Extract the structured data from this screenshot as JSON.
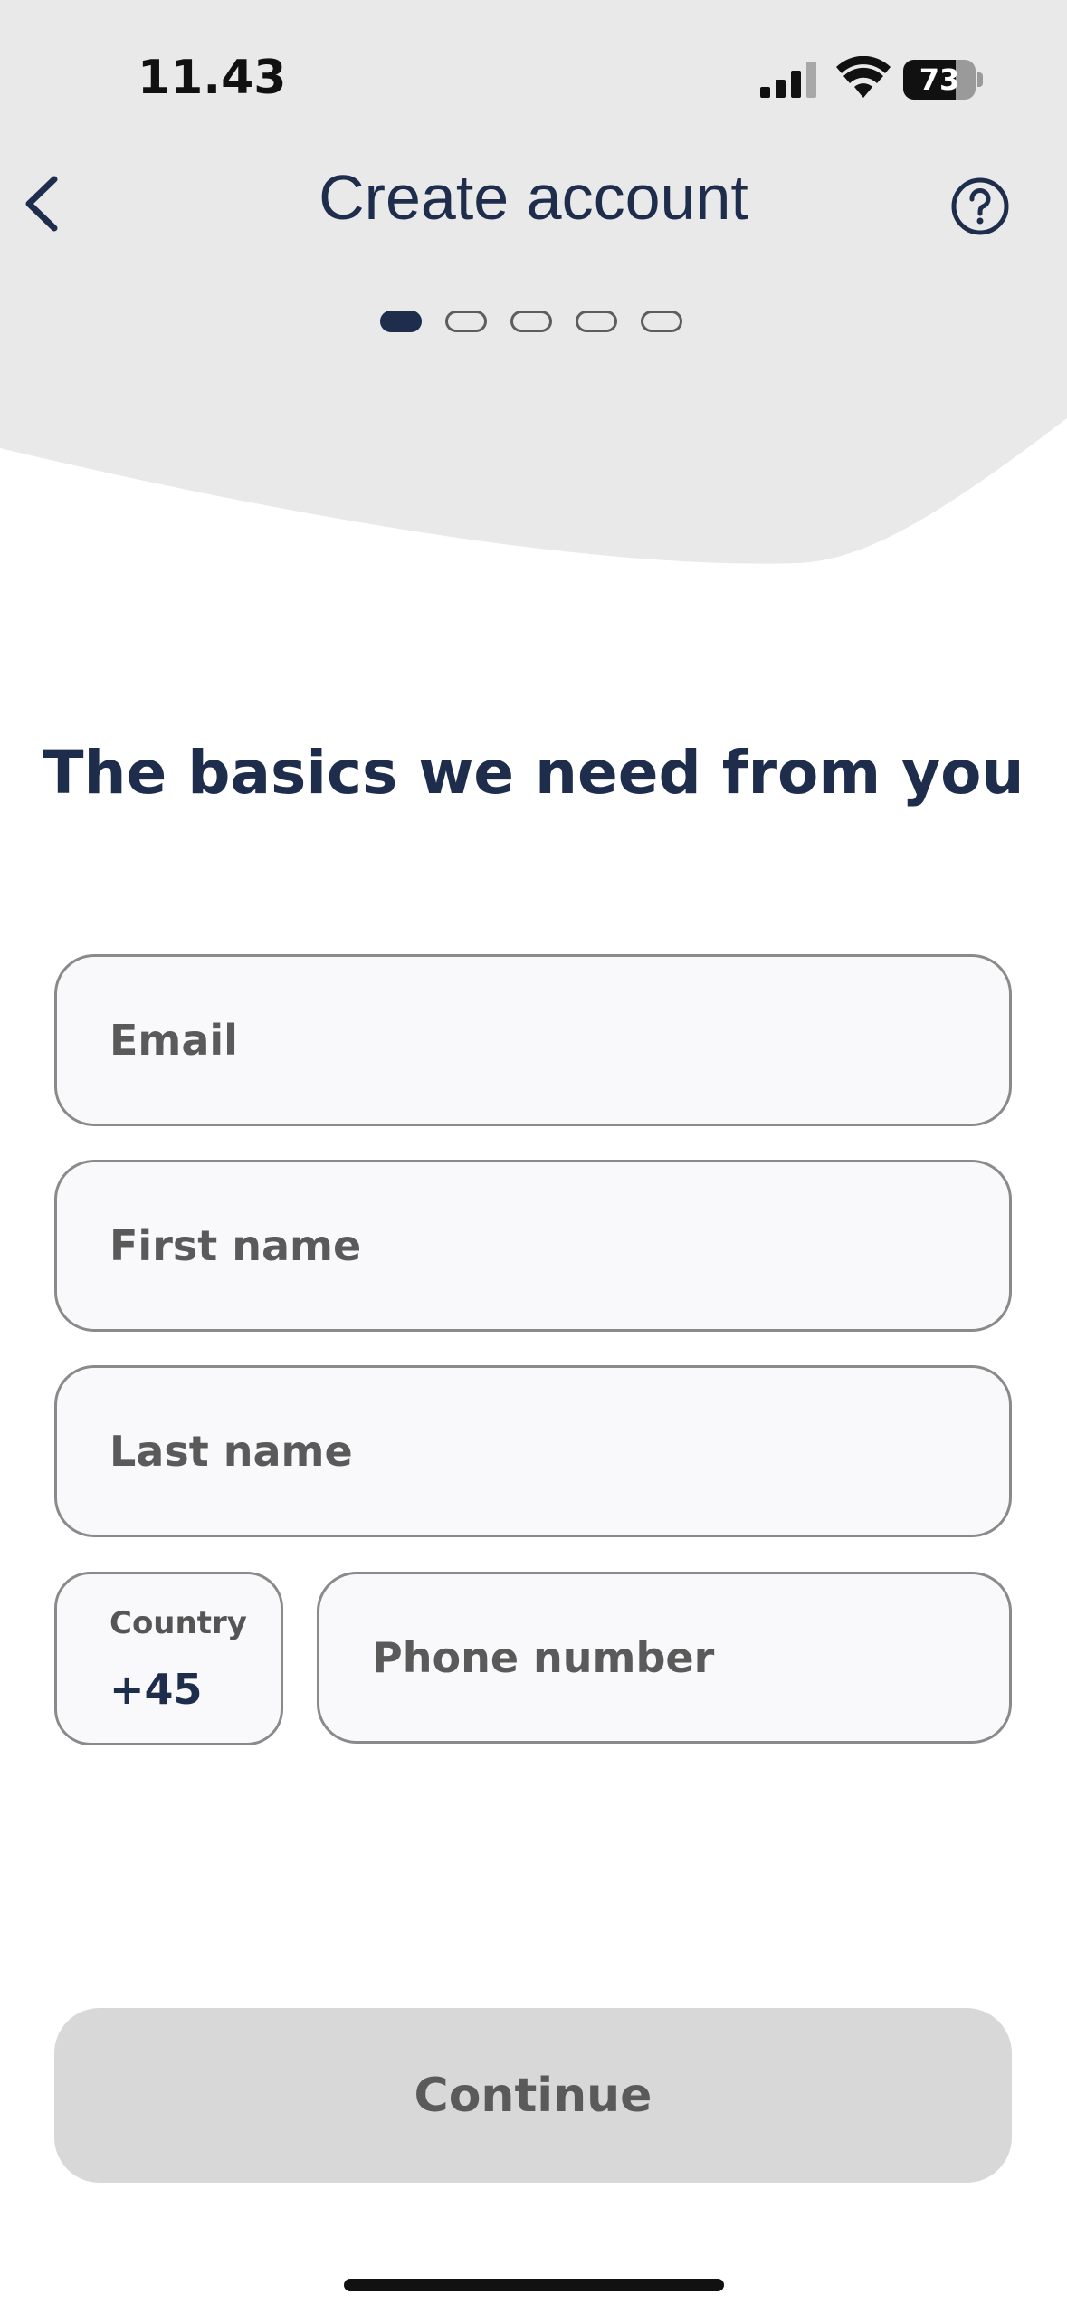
{
  "status_bar": {
    "time": "11.43",
    "battery_level": "73",
    "battery_fraction": 0.73
  },
  "nav": {
    "title": "Create account",
    "back_icon": "chevron-left-icon",
    "help_icon": "question-circle-icon"
  },
  "progress": {
    "total_steps": 5,
    "current_step": 1
  },
  "form": {
    "heading": "The basics we need from you",
    "email_placeholder": "Email",
    "first_name_placeholder": "First name",
    "last_name_placeholder": "Last name",
    "country_label": "Country",
    "country_code": "+45",
    "phone_placeholder": "Phone number"
  },
  "actions": {
    "continue_label": "Continue"
  },
  "colors": {
    "primary": "#1f2d4d",
    "header_bg": "#e9e9e9",
    "disabled_button": "#d8d8d8"
  }
}
